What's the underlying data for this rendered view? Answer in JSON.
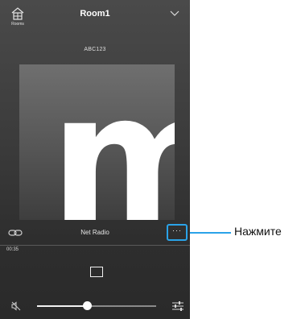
{
  "header": {
    "rooms_label": "Rooms",
    "room_title": "Room1"
  },
  "player": {
    "source_name": "ABC123",
    "artwork_letter": "m",
    "now_source": "Net Radio",
    "more_label": "···",
    "elapsed_time": "00:35",
    "volume_fraction": 0.42
  },
  "callout": {
    "text": "Нажмите"
  },
  "colors": {
    "accent": "#2aa3e8",
    "background_top": "#4a4a4a",
    "background_bottom": "#2a2a2a"
  },
  "icons": {
    "rooms": "house-icon",
    "room_select": "chevron-down-icon",
    "link": "link-icon",
    "more": "ellipsis-icon",
    "stop": "stop-icon",
    "mute": "speaker-mute-icon",
    "equalizer": "equalizer-icon"
  }
}
